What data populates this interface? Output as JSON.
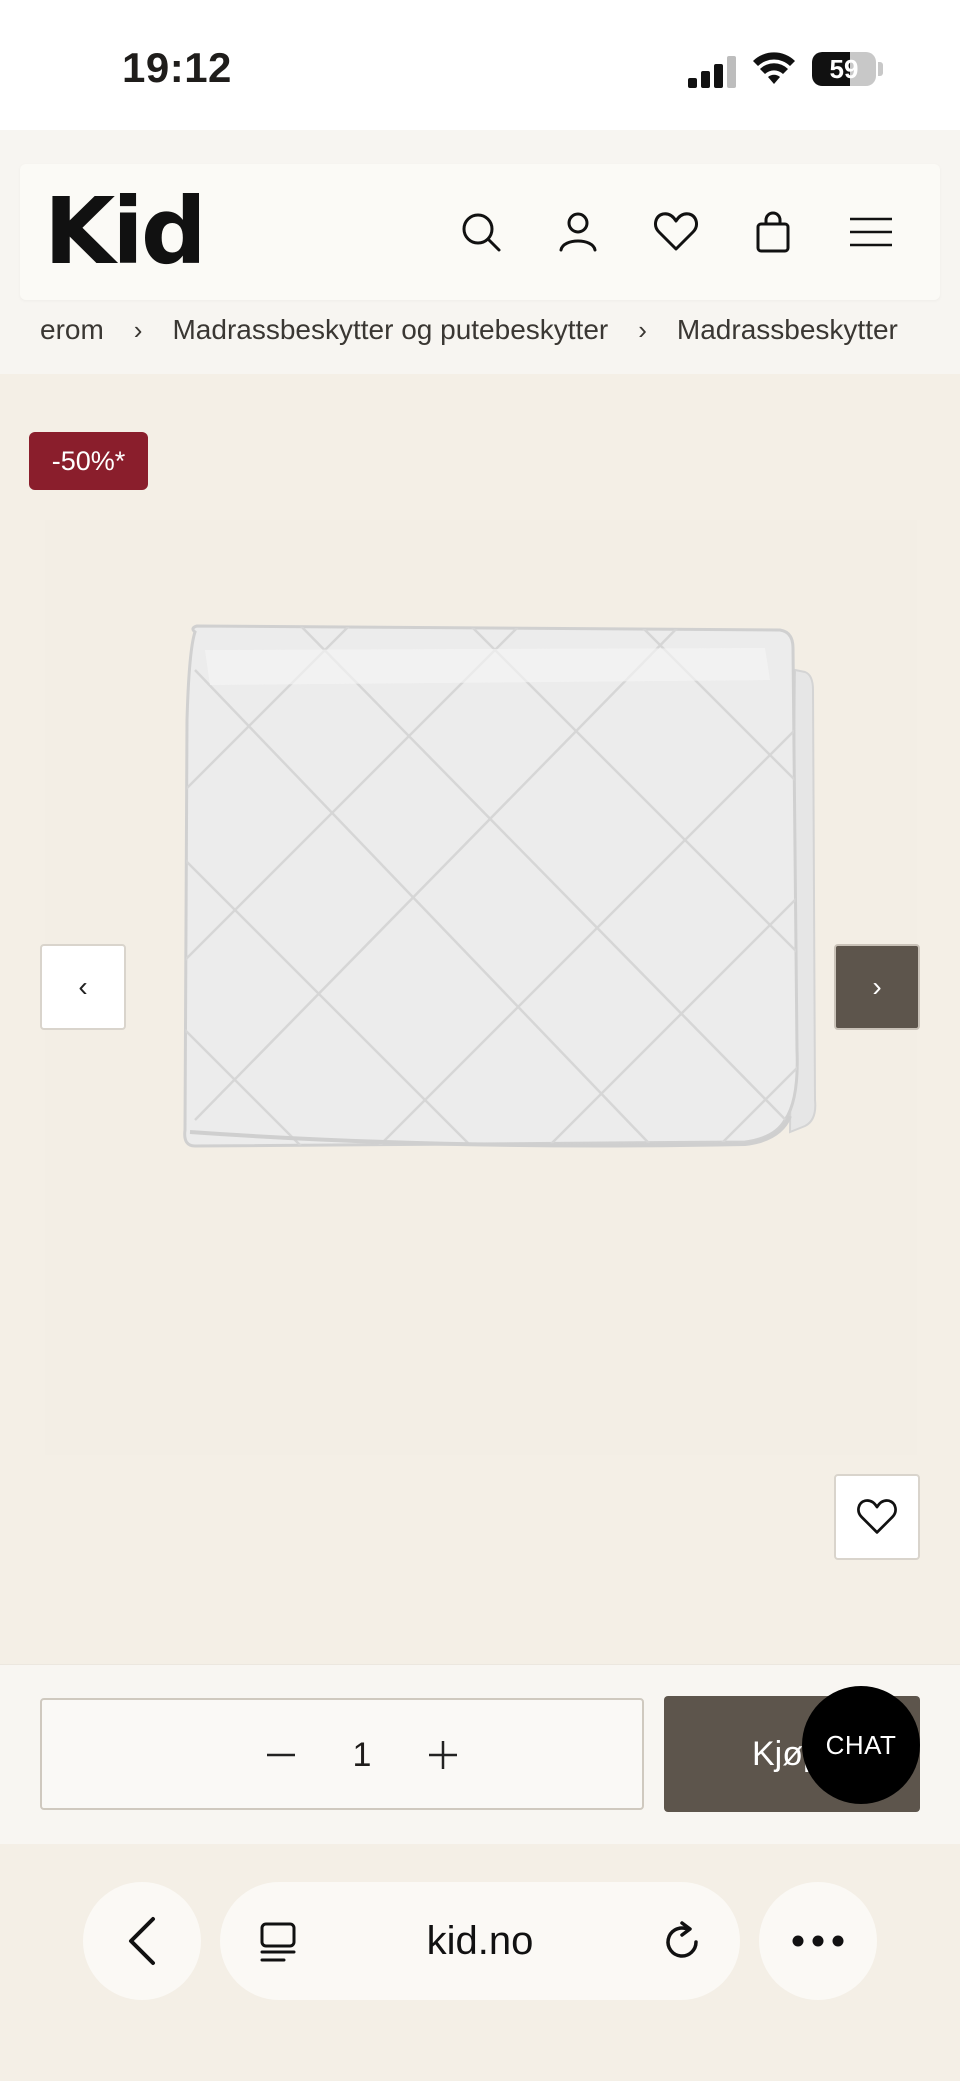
{
  "status_bar": {
    "time": "19:12",
    "battery_level": "59",
    "battery_fraction": 0.59,
    "icons": [
      "signal-icon",
      "wifi-icon",
      "battery-icon"
    ]
  },
  "header": {
    "logo_text": "Kid",
    "icons": [
      "search-icon",
      "account-icon",
      "heart-icon",
      "bag-icon",
      "menu-icon"
    ]
  },
  "breadcrumb": {
    "items": [
      "erom",
      "Madrassbeskytter og putebeskytter",
      "Madrassbeskytter"
    ],
    "separator": "›"
  },
  "product": {
    "badge": "-50%*",
    "image_alt_icon": "quilted-mattress-protector-image",
    "prev_label": "‹",
    "next_label": "›"
  },
  "purchase": {
    "quantity": "1",
    "buy_label": "Kjøp",
    "chat_label": "CHAT"
  },
  "browser": {
    "url": "kid.no",
    "icons": [
      "back-icon",
      "tabs-icon",
      "reload-icon",
      "more-icon"
    ]
  },
  "colors": {
    "page_background": "#f4efe6",
    "sale_badge": "#8a1e2c",
    "primary_button": "#5d554c",
    "chat_button": "#000000"
  }
}
